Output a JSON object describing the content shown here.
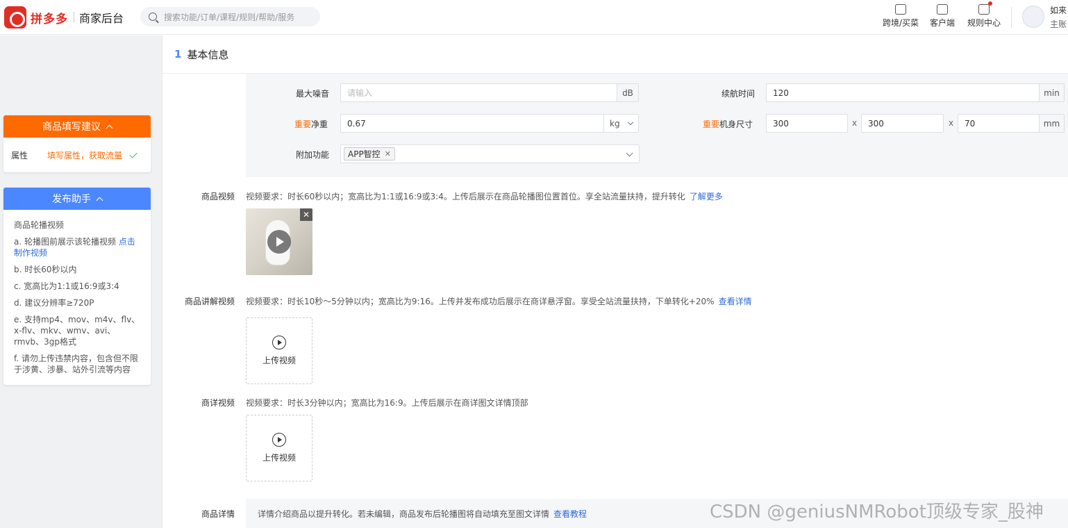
{
  "header": {
    "brand": "拼多多",
    "subtitle": "商家后台",
    "search_placeholder": "搜索功能/订单/课程/规则/帮助/服务",
    "nav": [
      {
        "label": "跨境/买菜",
        "icon": "store-icon"
      },
      {
        "label": "客户端",
        "icon": "desktop-icon"
      },
      {
        "label": "规则中心",
        "icon": "document-icon"
      }
    ],
    "user_name": "如来",
    "user_role": "主账"
  },
  "sidebar": {
    "suggest_title": "商品填写建议",
    "suggest_row_label": "属性",
    "suggest_row_tip": "填写属性，获取流量",
    "helper_title": "发布助手",
    "helper_heading": "商品轮播视频",
    "helper_a_text": "a. 轮播图前展示该轮播视频",
    "helper_a_link": "点击制作视频",
    "helper_b": "b. 时长60秒以内",
    "helper_c": "c. 宽高比为1:1或16:9或3:4",
    "helper_d": "d. 建议分辨率≥720P",
    "helper_e": "e. 支持mp4、mov、m4v、flv、x-flv、mkv、wmv、avi、rmvb、3gp格式",
    "helper_f": "f. 请勿上传违禁内容，包含但不限于涉黄、涉暴、站外引流等内容"
  },
  "section": {
    "number": "1",
    "title": "基本信息"
  },
  "attributes": {
    "important_tag": "重要",
    "max_noise_label": "最大噪音",
    "max_noise_placeholder": "请输入",
    "max_noise_unit": "dB",
    "battery_label": "续航时间",
    "battery_value": "120",
    "battery_unit": "min",
    "weight_label": "净重",
    "weight_value": "0.67",
    "weight_unit": "kg",
    "size_label": "机身尺寸",
    "size_l": "300",
    "size_w": "300",
    "size_h": "70",
    "size_sep": "x",
    "size_unit": "mm",
    "extra_label": "附加功能",
    "extra_tag": "APP智控"
  },
  "videos": {
    "main_label": "商品视频",
    "main_desc": "视频要求：时长60秒以内；宽高比为1:1或16:9或3:4。上传后展示在商品轮播图位置首位。享全站流量扶持，提升转化",
    "main_link": "了解更多",
    "explain_label": "商品讲解视频",
    "explain_desc": "视频要求：时长10秒～5分钟以内；宽高比为9:16。上传并发布成功后展示在商详悬浮窗。享受全站流量扶持，下单转化+20%",
    "explain_link": "查看详情",
    "detail_label": "商详视频",
    "detail_desc": "视频要求：时长3分钟以内；宽高比为16:9。上传后展示在商详图文详情顶部",
    "upload_label": "上传视频"
  },
  "details": {
    "label": "商品详情",
    "desc": "详情介绍商品以提升转化。若未编辑，商品发布后轮播图将自动填充至图文详情",
    "link": "查看教程"
  },
  "watermark": "CSDN @geniusNMRobot顶级专家_股神"
}
